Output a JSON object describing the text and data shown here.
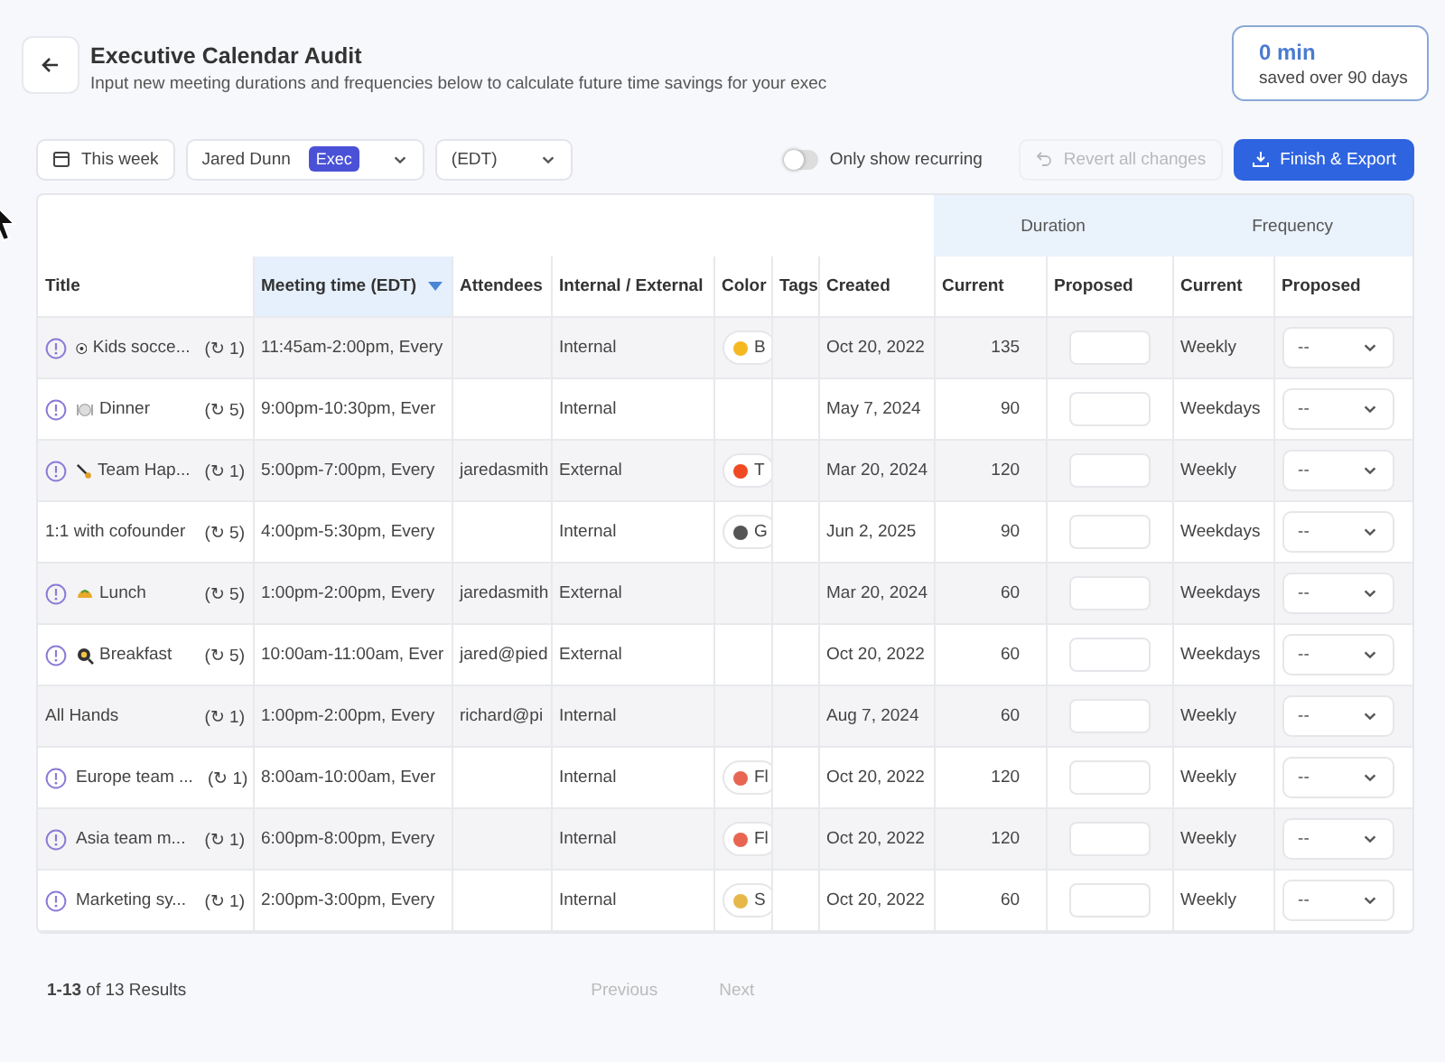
{
  "header": {
    "title": "Executive Calendar Audit",
    "subtitle": "Input new meeting durations and frequencies below to calculate future time savings for your exec"
  },
  "savings": {
    "value": "0 min",
    "label": "saved over 90 days"
  },
  "toolbar": {
    "date_range": {
      "label": "This week"
    },
    "person": {
      "name": "Jared Dunn",
      "badge": "Exec"
    },
    "timezone": {
      "label": "(EDT)"
    },
    "recurring_toggle": {
      "label": "Only show recurring",
      "on": false
    },
    "revert": {
      "label": "Revert all changes",
      "disabled": true
    },
    "export": {
      "label": "Finish & Export"
    }
  },
  "table": {
    "groups": [
      {
        "label": "Duration"
      },
      {
        "label": "Frequency"
      }
    ],
    "columns": [
      {
        "label": "Title",
        "sorted": false
      },
      {
        "label": "Meeting time (EDT)",
        "sorted": true
      },
      {
        "label": "Attendees",
        "sorted": false
      },
      {
        "label": "Internal / External",
        "sorted": false
      },
      {
        "label": "Color",
        "sorted": false
      },
      {
        "label": "Tags",
        "sorted": false
      },
      {
        "label": "Created",
        "sorted": false
      },
      {
        "label": "Current",
        "sorted": false
      },
      {
        "label": "Proposed",
        "sorted": false
      },
      {
        "label": "Current",
        "sorted": false
      },
      {
        "label": "Proposed",
        "sorted": false
      }
    ],
    "rows": [
      {
        "warning": true,
        "kind": "ball",
        "title": "Kids socce...",
        "recurrence": "(↻ 1)",
        "time": "11:45am-2:00pm, Every",
        "type": "Internal",
        "tag": {
          "color": "#f5b820",
          "label": "B"
        },
        "created": "Oct 20, 2022",
        "duration": "135",
        "frequency": "Weekly",
        "proposed_frequency": "--"
      },
      {
        "warning": true,
        "kind": "plate",
        "title": "Dinner",
        "recurrence": "(↻ 5)",
        "time": "9:00pm-10:30pm, Ever",
        "type": "Internal",
        "created": "May 7, 2024",
        "duration": "90",
        "frequency": "Weekdays",
        "proposed_frequency": "--"
      },
      {
        "warning": true,
        "kind": "racket",
        "title": "Team Hap...",
        "recurrence": "(↻ 1)",
        "time": "5:00pm-7:00pm, Every",
        "attendees": "jaredasmith",
        "type": "External",
        "tag": {
          "color": "#f04a23",
          "label": "T"
        },
        "created": "Mar 20, 2024",
        "duration": "120",
        "frequency": "Weekly",
        "proposed_frequency": "--"
      },
      {
        "warning": false,
        "title": "1:1 with cofounder",
        "recurrence": "(↻ 5)",
        "time": "4:00pm-5:30pm, Every",
        "type": "Internal",
        "tag": {
          "color": "#555555",
          "label": "G"
        },
        "created": "Jun 2, 2025",
        "duration": "90",
        "frequency": "Weekdays",
        "proposed_frequency": "--"
      },
      {
        "warning": true,
        "kind": "taco",
        "title": "Lunch",
        "recurrence": "(↻ 5)",
        "time": "1:00pm-2:00pm, Every",
        "attendees": "jaredasmith",
        "type": "External",
        "created": "Mar 20, 2024",
        "duration": "60",
        "frequency": "Weekdays",
        "proposed_frequency": "--"
      },
      {
        "warning": true,
        "kind": "pan",
        "title": "Breakfast",
        "recurrence": "(↻ 5)",
        "time": "10:00am-11:00am, Ever",
        "attendees": "jared@pied",
        "type": "External",
        "created": "Oct 20, 2022",
        "duration": "60",
        "frequency": "Weekdays",
        "proposed_frequency": "--"
      },
      {
        "warning": false,
        "title": "All Hands",
        "recurrence": "(↻ 1)",
        "time": "1:00pm-2:00pm, Every",
        "attendees": "richard@pi",
        "type": "Internal",
        "created": "Aug 7, 2024",
        "duration": "60",
        "frequency": "Weekly",
        "proposed_frequency": "--"
      },
      {
        "warning": true,
        "title": "Europe team ...",
        "recurrence": "(↻ 1)",
        "time": "8:00am-10:00am, Ever",
        "type": "Internal",
        "tag": {
          "color": "#e86552",
          "label": "Fl"
        },
        "created": "Oct 20, 2022",
        "duration": "120",
        "frequency": "Weekly",
        "proposed_frequency": "--"
      },
      {
        "warning": true,
        "title": "Asia team m...",
        "recurrence": "(↻ 1)",
        "time": "6:00pm-8:00pm, Every",
        "type": "Internal",
        "tag": {
          "color": "#e86552",
          "label": "Fl"
        },
        "created": "Oct 20, 2022",
        "duration": "120",
        "frequency": "Weekly",
        "proposed_frequency": "--"
      },
      {
        "warning": true,
        "title": "Marketing sy...",
        "recurrence": "(↻ 1)",
        "time": "2:00pm-3:00pm, Every",
        "type": "Internal",
        "tag": {
          "color": "#e6b84a",
          "label": "S"
        },
        "created": "Oct 20, 2022",
        "duration": "60",
        "frequency": "Weekly",
        "proposed_frequency": "--"
      }
    ]
  },
  "footer": {
    "summary": "**1-13** of 13 Results",
    "previous": {
      "label": "Previous",
      "disabled": true
    },
    "next": {
      "label": "Next",
      "disabled": true
    }
  }
}
